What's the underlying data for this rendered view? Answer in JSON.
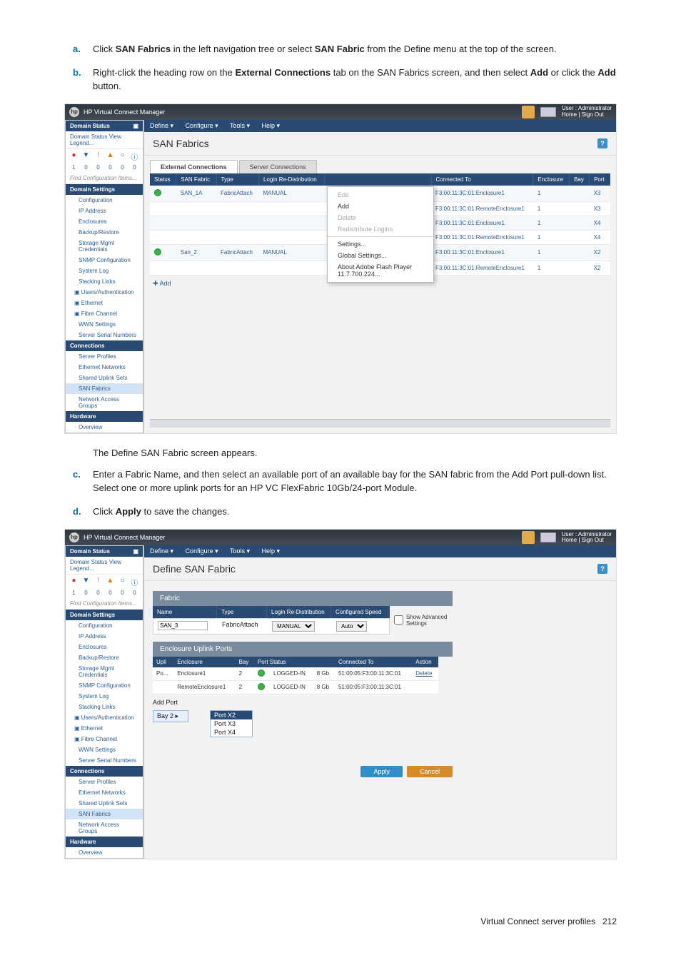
{
  "steps": {
    "a": {
      "mk": "a.",
      "pre": "Click ",
      "b1": "SAN Fabrics",
      "mid": " in the left navigation tree or select ",
      "b2": "SAN Fabric",
      "post": " from the Define menu at the top of the screen."
    },
    "b": {
      "mk": "b.",
      "pre": "Right-click the heading row on the ",
      "b1": "External Connections",
      "mid": " tab on the SAN Fabrics screen, and then select ",
      "b2": "Add",
      "mid2": " or click the ",
      "b3": "Add",
      "post": " button."
    },
    "after1": "The Define SAN Fabric screen appears.",
    "c": {
      "mk": "c.",
      "text": "Enter a Fabric Name, and then select an available port of an available bay for the SAN fabric from the Add Port pull-down list. Select one or more uplink ports for an HP VC FlexFabric 10Gb/24-port Module."
    },
    "d": {
      "mk": "d.",
      "pre": "Click ",
      "b1": "Apply",
      "post": " to save the changes."
    }
  },
  "app": {
    "title": "HP Virtual Connect Manager",
    "userline1": "User : Administrator",
    "userline2": "Home  |  Sign Out",
    "menu": {
      "define": "Define ▾",
      "configure": "Configure ▾",
      "tools": "Tools ▾",
      "help": "Help ▾"
    }
  },
  "sidebar": {
    "domainStatus": "Domain Status",
    "statusLink": "Domain Status   View Legend...",
    "icons": [
      "●",
      "▼",
      "!",
      "▲",
      "○",
      "ⓘ"
    ],
    "iconColors": [
      "#c33",
      "#1864ab",
      "#e67700",
      "#e67700",
      "#1864ab",
      "#1864ab"
    ],
    "nums": [
      "1",
      "0",
      "0",
      "0",
      "0",
      "0"
    ],
    "search": "Find Configuration Items...",
    "domainSettings": "Domain Settings",
    "items1": [
      "Configuration",
      "IP Address",
      "Enclosures",
      "Backup/Restore",
      "Storage Mgmt Credentials",
      "SNMP Configuration",
      "System Log",
      "Stacking Links"
    ],
    "ua": "Users/Authentication",
    "eth": "Ethernet",
    "fc": "Fibre Channel",
    "fcitems": [
      "WWN Settings",
      "Server Serial Numbers"
    ],
    "connections": "Connections",
    "conitems": [
      "Server Profiles",
      "Ethernet Networks",
      "Shared Uplink Sets",
      "SAN Fabrics",
      "Network Access Groups"
    ],
    "hardware": "Hardware",
    "overview": "Overview"
  },
  "scr1": {
    "pageTitle": "SAN Fabrics",
    "tabs": [
      "External Connections",
      "Server Connections"
    ],
    "headers": [
      "Status",
      "SAN Fabric",
      "Type",
      "Login Re-Distribution",
      "",
      "",
      "Connected To",
      "Enclosure",
      "Bay",
      "Port"
    ],
    "rows1": [
      {
        "fab": "SAN_1A",
        "type": "FabricAttach",
        "login": "MANUAL",
        "to": "",
        "connTo": "F3:00:11:3C:01:Enclosure1",
        "bay": "1",
        "port": "X3"
      },
      {
        "fab": "",
        "type": "",
        "login": "",
        "to": "",
        "connTo": "F3:00:11:3C:01:RemoteEnclosure1",
        "bay": "1",
        "port": "X3"
      },
      {
        "fab": "",
        "type": "",
        "login": "",
        "to": "",
        "connTo": "F3:00:11:3C:01:Enclosure1",
        "bay": "1",
        "port": "X4"
      },
      {
        "fab": "",
        "type": "",
        "login": "",
        "to": "",
        "connTo": "F3:00:11:3C:01:RemoteEnclosure1",
        "bay": "1",
        "port": "X4"
      }
    ],
    "rows2": [
      {
        "fab": "San_2",
        "type": "FabricAttach",
        "login": "MANUAL",
        "to": "",
        "connTo": "F3:00:11:3C:01:Enclosure1",
        "bay": "1",
        "port": "X2"
      },
      {
        "fab": "",
        "type": "",
        "login": "",
        "to": "",
        "connTo": "F3:00:11:3C:01:RemoteEnclosure1",
        "bay": "1",
        "port": "X2"
      }
    ],
    "add": "Add",
    "ctx": [
      "Edit",
      "Add",
      "Delete",
      "Redistribute Logins",
      "Settings...",
      "Global Settings...",
      "About Adobe Flash Player 11.7.700.224..."
    ]
  },
  "scr2": {
    "pageTitle": "Define SAN Fabric",
    "panelFabric": "Fabric",
    "fHeaders": [
      "Name",
      "Type",
      "Login Re-Distribution",
      "Configured Speed"
    ],
    "fabricName": "SAN_3",
    "fabricType": "FabricAttach",
    "loginDist": "MANUAL",
    "speed": "Auto",
    "advSettings": "Show Advanced Settings",
    "uplinkTitle": "Enclosure Uplink Ports",
    "uHeaders": [
      "Upli",
      "Enclosure",
      "Bay",
      "Port Status",
      "",
      "",
      "Connected To",
      "Action"
    ],
    "uRows": [
      {
        "up": "Po...",
        "enc": "Enclosure1",
        "bay": "2",
        "stat": "LOGGED-IN",
        "sp": "8 Gb",
        "conn": "51:00:05:F3:00:11:3C:01",
        "act": "Delete"
      },
      {
        "up": "",
        "enc": "RemoteEnclosure1",
        "bay": "2",
        "stat": "LOGGED-IN",
        "sp": "8 Gb",
        "conn": "51:00:05:F3:00:11:3C:01",
        "act": ""
      }
    ],
    "addPort": "Add Port",
    "bay2": "Bay 2",
    "portX2": "Port X2",
    "portX3": "Port X3",
    "portX4": "Port X4",
    "apply": "Apply",
    "cancel": "Cancel"
  },
  "footer": {
    "title": "Virtual Connect server profiles",
    "page": "212"
  }
}
